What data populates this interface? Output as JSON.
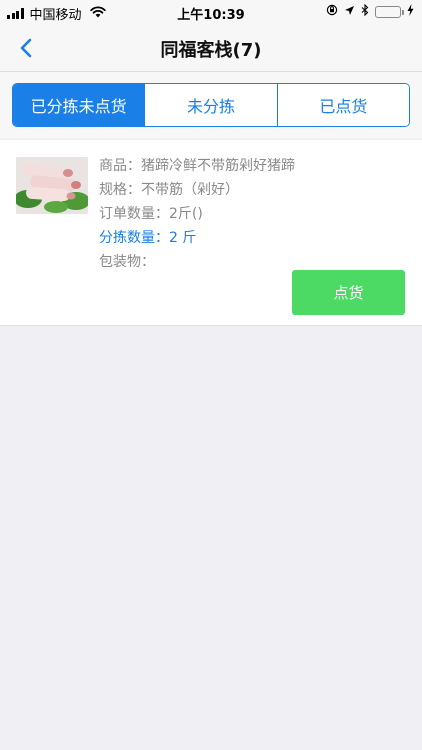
{
  "status_bar": {
    "carrier": "中国移动",
    "time": "上午10:39"
  },
  "nav": {
    "title": "同福客栈(7)"
  },
  "tabs": [
    {
      "label": "已分拣未点货",
      "active": true
    },
    {
      "label": "未分拣",
      "active": false
    },
    {
      "label": "已点货",
      "active": false
    }
  ],
  "order": {
    "product_label": "商品：",
    "product": "猪蹄冷鲜不带筋剁好猪蹄",
    "spec_label": "规格：",
    "spec": "不带筋（剁好）",
    "order_qty_label": "订单数量：",
    "order_qty": "2斤()",
    "sorted_qty_label": "分拣数量：",
    "sorted_qty": "2 斤",
    "packaging_label": "包装物：",
    "packaging": "",
    "action_label": "点货"
  },
  "colors": {
    "accent": "#1a7fe6",
    "action": "#4cd964",
    "background": "#efeff4"
  }
}
